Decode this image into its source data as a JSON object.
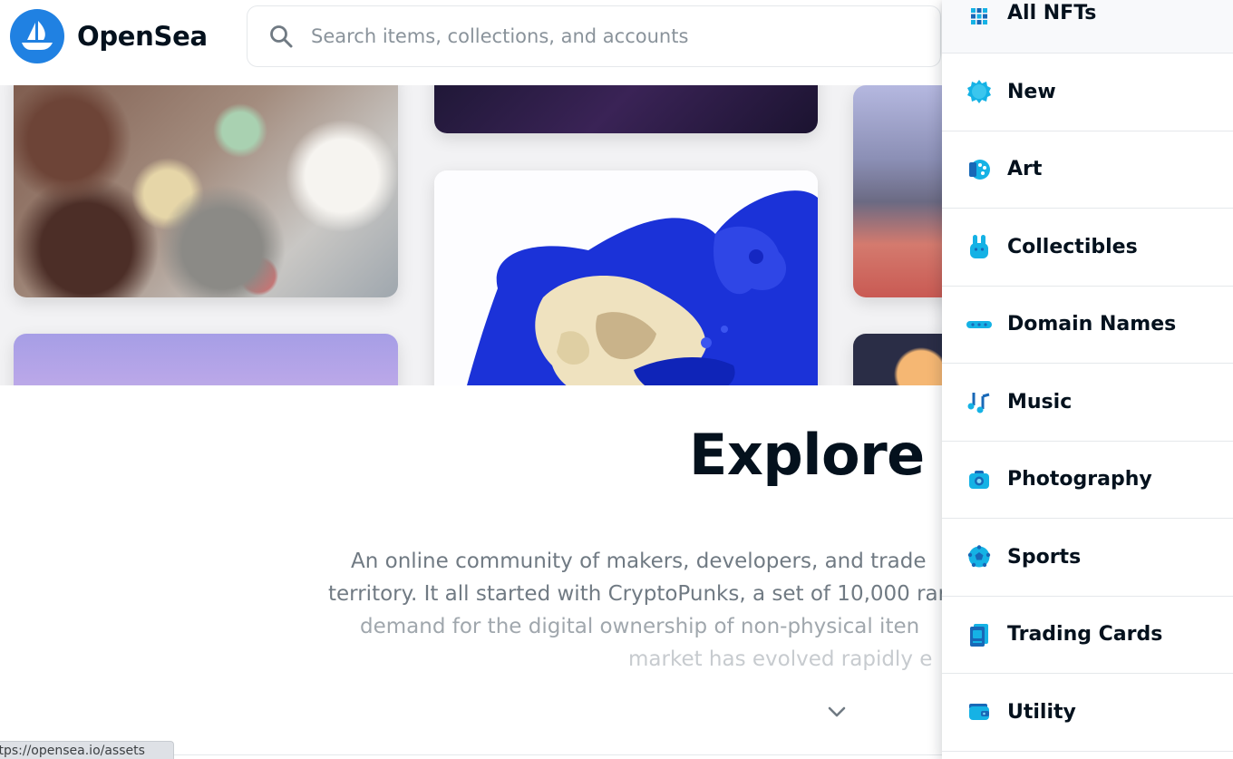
{
  "header": {
    "brand": "OpenSea",
    "search": {
      "placeholder": "Search items, collections, and accounts",
      "value": ""
    }
  },
  "main": {
    "title": "Explore A",
    "description_lines": [
      "An online community of makers, developers, and trade",
      "territory. It all started with CryptoPunks, a set of 10,000 rar",
      "demand for the digital ownership of non-physical iten",
      "market has evolved rapidly e"
    ]
  },
  "status_bar": {
    "url": "ttps://opensea.io/assets"
  },
  "dropdown": {
    "items": [
      {
        "label": "All NFTs",
        "icon": "grid-icon"
      },
      {
        "label": "New",
        "icon": "new-badge-icon"
      },
      {
        "label": "Art",
        "icon": "art-palette-icon"
      },
      {
        "label": "Collectibles",
        "icon": "bunny-icon"
      },
      {
        "label": "Domain Names",
        "icon": "domain-bar-icon"
      },
      {
        "label": "Music",
        "icon": "music-note-icon"
      },
      {
        "label": "Photography",
        "icon": "camera-icon"
      },
      {
        "label": "Sports",
        "icon": "soccer-ball-icon"
      },
      {
        "label": "Trading Cards",
        "icon": "trading-card-icon"
      },
      {
        "label": "Utility",
        "icon": "wallet-icon"
      }
    ]
  },
  "colors": {
    "brand_blue": "#2081e2",
    "icon_cyan": "#15b2e5",
    "icon_dark_blue": "#1868b7",
    "text_primary": "#04111d",
    "text_secondary": "#707a83"
  }
}
